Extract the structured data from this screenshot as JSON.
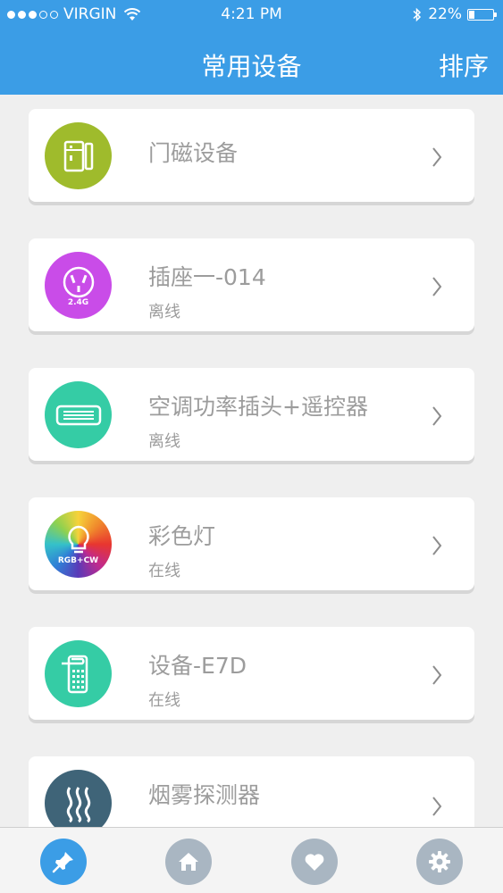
{
  "status_bar": {
    "carrier": "VIRGIN",
    "time": "4:21 PM",
    "battery": "22%",
    "battery_level": 0.22
  },
  "nav": {
    "title": "常用设备",
    "sort_label": "排序"
  },
  "devices": [
    {
      "name": "门磁设备",
      "status": "",
      "icon": "door-sensor-icon",
      "color": "#9fbb2c"
    },
    {
      "name": "插座一-014",
      "status": "离线",
      "icon": "socket-icon",
      "color": "#c94ce8",
      "badge": "2.4G"
    },
    {
      "name": "空调功率插头+遥控器",
      "status": "离线",
      "icon": "air-conditioner-icon",
      "color": "#35cca5"
    },
    {
      "name": "彩色灯",
      "status": "在线",
      "icon": "color-bulb-icon",
      "color": "#e8532f",
      "badge": "RGB+CW"
    },
    {
      "name": "设备-E7D",
      "status": "在线",
      "icon": "door-lock-icon",
      "color": "#35cca5"
    },
    {
      "name": "烟雾探测器",
      "status": "",
      "icon": "smoke-detector-icon",
      "color": "#3f6478"
    }
  ],
  "tabs": [
    {
      "name": "pin-tab",
      "icon": "pin-icon",
      "active": true
    },
    {
      "name": "home-tab",
      "icon": "home-icon",
      "active": false
    },
    {
      "name": "favorites-tab",
      "icon": "heart-icon",
      "active": false
    },
    {
      "name": "settings-tab",
      "icon": "gear-icon",
      "active": false
    }
  ],
  "colors": {
    "accent": "#3b9de6",
    "tab_inactive": "#a9b6c2"
  }
}
